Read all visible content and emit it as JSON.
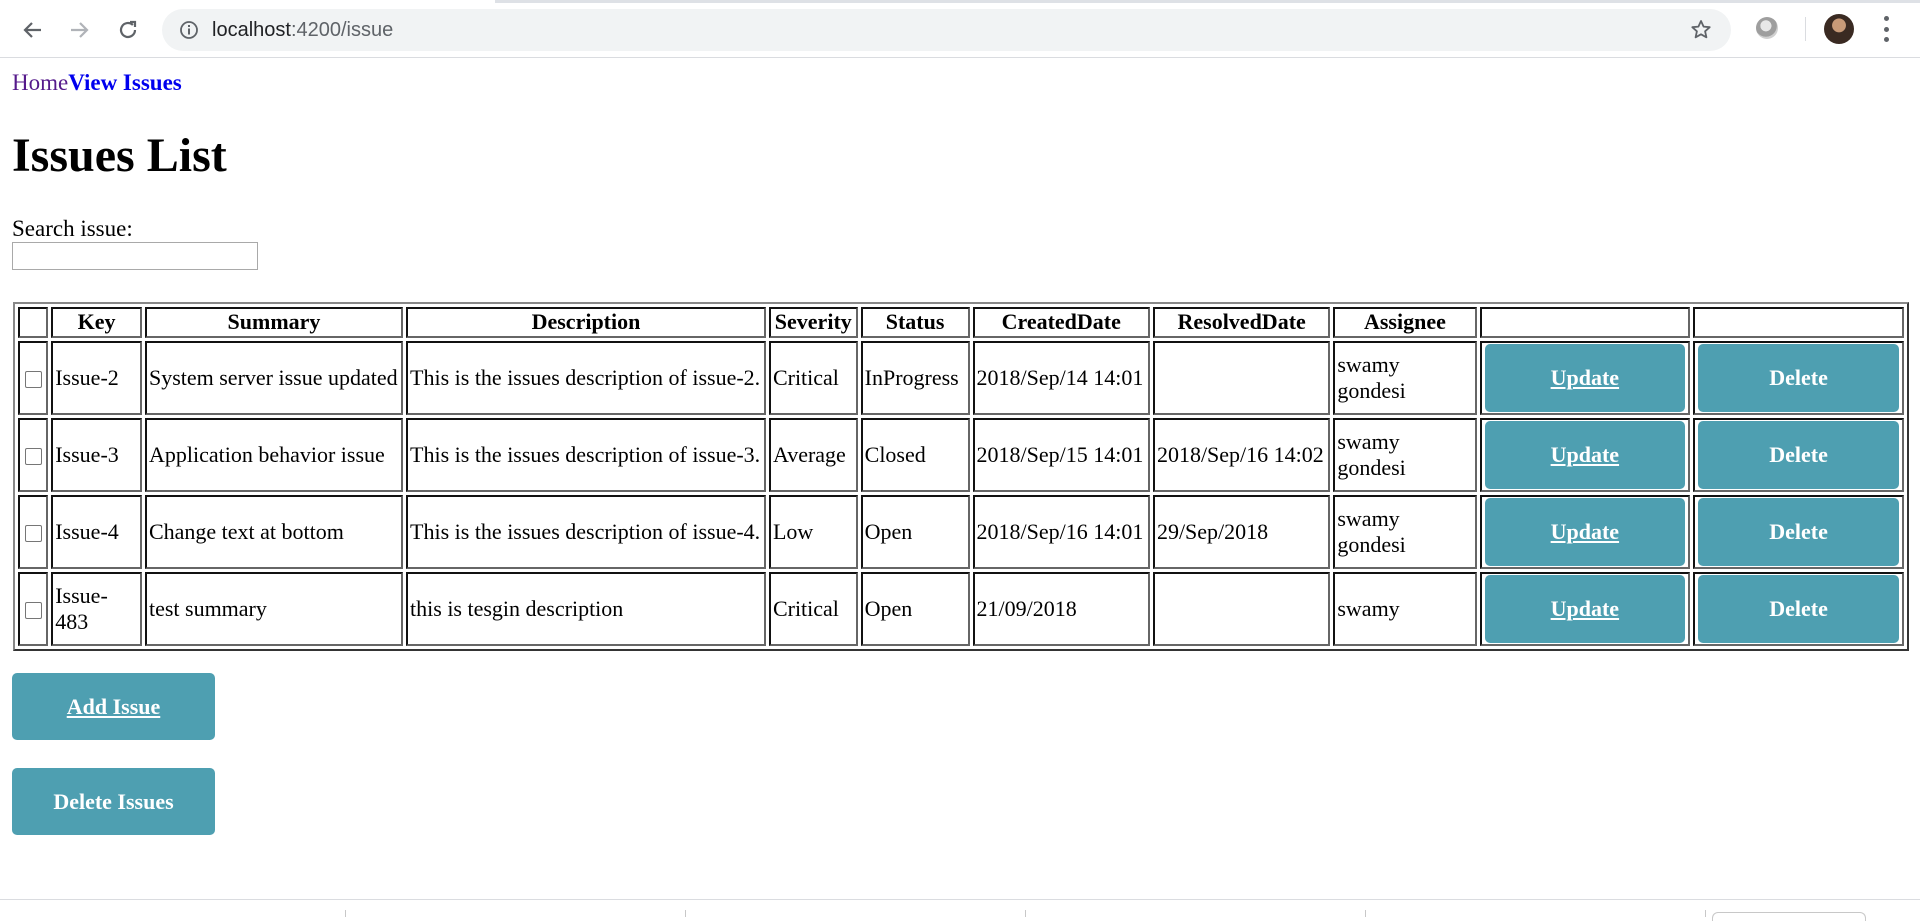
{
  "browser": {
    "url_host": "localhost",
    "url_path": ":4200/issue"
  },
  "nav": {
    "home": "Home",
    "view_issues": "View Issues"
  },
  "page_title": "Issues List",
  "search": {
    "label": "Search issue:",
    "value": ""
  },
  "table": {
    "headers": [
      "",
      "Key",
      "Summary",
      "Description",
      "Severity",
      "Status",
      "CreatedDate",
      "ResolvedDate",
      "Assignee",
      "",
      ""
    ],
    "rows": [
      {
        "key": "Issue-2",
        "summary": "System server issue updated",
        "description": "This is the issues description of issue-2.",
        "severity": "Critical",
        "status": "InProgress",
        "created": "2018/Sep/14 14:01",
        "resolved": "",
        "assignee": "swamy gondesi",
        "update": "Update",
        "delete": "Delete"
      },
      {
        "key": "Issue-3",
        "summary": "Application behavior issue",
        "description": "This is the issues description of issue-3.",
        "severity": "Average",
        "status": "Closed",
        "created": "2018/Sep/15 14:01",
        "resolved": "2018/Sep/16 14:02",
        "assignee": "swamy gondesi",
        "update": "Update",
        "delete": "Delete"
      },
      {
        "key": "Issue-4",
        "summary": "Change text at bottom",
        "description": "This is the issues description of issue-4.",
        "severity": "Low",
        "status": "Open",
        "created": "2018/Sep/16 14:01",
        "resolved": "29/Sep/2018",
        "assignee": "swamy gondesi",
        "update": "Update",
        "delete": "Delete"
      },
      {
        "key": "Issue-483",
        "summary": "test summary",
        "description": "this is tesgin description",
        "severity": "Critical",
        "status": "Open",
        "created": "21/09/2018",
        "resolved": "",
        "assignee": "swamy",
        "update": "Update",
        "delete": "Delete"
      }
    ]
  },
  "actions": {
    "add": "Add Issue",
    "delete_many": "Delete Issues"
  },
  "colors": {
    "button_bg": "#4e9fb1",
    "link_visited": "#551a8b",
    "link": "#0000ee"
  }
}
